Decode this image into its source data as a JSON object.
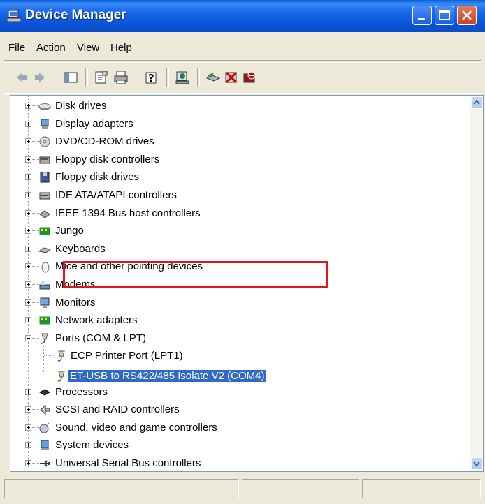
{
  "window": {
    "title": "Device Manager"
  },
  "menu": {
    "items": [
      "File",
      "Action",
      "View",
      "Help"
    ]
  },
  "toolbar": {
    "icons": [
      "back-arrow-icon",
      "forward-arrow-icon",
      "show-hide-tree-icon",
      "properties-icon",
      "print-icon",
      "help-icon",
      "scan-hardware-icon",
      "update-driver-icon",
      "uninstall-icon",
      "disable-icon"
    ]
  },
  "tree": {
    "items": [
      {
        "label": "Disk drives",
        "icon": "disk-drive-icon",
        "expanded": false
      },
      {
        "label": "Display adapters",
        "icon": "display-adapter-icon",
        "expanded": false
      },
      {
        "label": "DVD/CD-ROM drives",
        "icon": "cdrom-icon",
        "expanded": false
      },
      {
        "label": "Floppy disk controllers",
        "icon": "floppy-controller-icon",
        "expanded": false
      },
      {
        "label": "Floppy disk drives",
        "icon": "floppy-drive-icon",
        "expanded": false
      },
      {
        "label": "IDE ATA/ATAPI controllers",
        "icon": "ide-controller-icon",
        "expanded": false
      },
      {
        "label": "IEEE 1394 Bus host controllers",
        "icon": "ieee1394-icon",
        "expanded": false
      },
      {
        "label": "Jungo",
        "icon": "jungo-board-icon",
        "expanded": false
      },
      {
        "label": "Keyboards",
        "icon": "keyboard-icon",
        "expanded": false
      },
      {
        "label": "Mice and other pointing devices",
        "icon": "mouse-icon",
        "expanded": false
      },
      {
        "label": "Modems",
        "icon": "modem-icon",
        "expanded": false
      },
      {
        "label": "Monitors",
        "icon": "monitor-icon",
        "expanded": false
      },
      {
        "label": "Network adapters",
        "icon": "network-adapter-icon",
        "expanded": false
      },
      {
        "label": "Ports (COM & LPT)",
        "icon": "port-icon",
        "expanded": true,
        "children": [
          {
            "label": "ECP Printer Port (LPT1)",
            "icon": "port-icon"
          },
          {
            "label": "ET-USB to RS422/485 Isolate V2 (COM4)",
            "icon": "port-icon",
            "selected": true
          }
        ]
      },
      {
        "label": "Processors",
        "icon": "processor-icon",
        "expanded": false
      },
      {
        "label": "SCSI and RAID controllers",
        "icon": "scsi-icon",
        "expanded": false
      },
      {
        "label": "Sound, video and game controllers",
        "icon": "sound-icon",
        "expanded": false
      },
      {
        "label": "System devices",
        "icon": "system-device-icon",
        "expanded": false
      },
      {
        "label": "Universal Serial Bus controllers",
        "icon": "usb-icon",
        "expanded": false
      }
    ]
  },
  "colors": {
    "selection": "#316ac5",
    "highlight_box": "#e3161d",
    "titlebar": "#0a55d8"
  }
}
